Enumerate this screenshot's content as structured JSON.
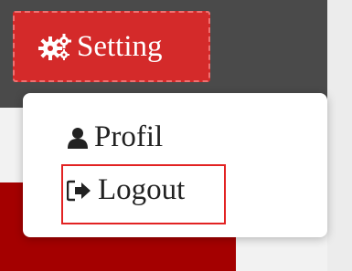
{
  "header": {
    "setting_button": {
      "label": "Setting",
      "icon": "cogs-icon",
      "bg_color": "#d42a2a"
    }
  },
  "dropdown_menu": {
    "items": [
      {
        "label": "Profil",
        "icon": "user-icon"
      },
      {
        "label": "Logout",
        "icon": "sign-out-icon"
      }
    ]
  },
  "highlight": {
    "target": "Logout",
    "color": "#e22222"
  },
  "colors": {
    "topbar": "#4a4a4a",
    "sidebar_accent": "#a40000"
  }
}
